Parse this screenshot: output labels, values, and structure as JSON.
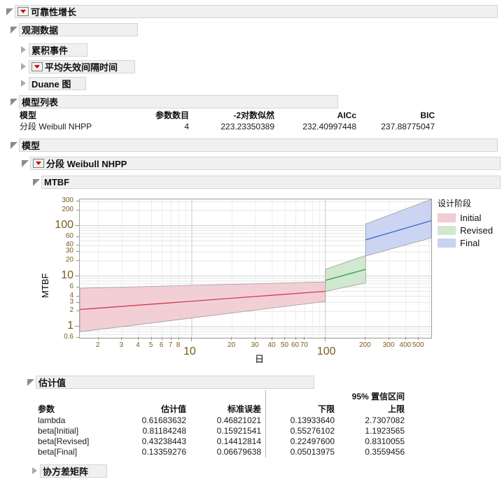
{
  "window": {
    "title": "可靠性增长"
  },
  "outline": {
    "root_label": "可靠性增长",
    "observed_data_label": "观测数据",
    "cumulative_events_label": "累积事件",
    "mtbf_interval_label": "平均失效间隔时间",
    "duane_plot_label": "Duane 图",
    "model_list_label": "模型列表",
    "model_label": "模型",
    "piecewise_weibull_label": "分段 Weibull NHPP",
    "mtbf_label": "MTBF",
    "estimates_label": "估计值",
    "covariance_label": "协方差矩阵"
  },
  "model_list": {
    "headers": [
      "模型",
      "参数数目",
      "-2对数似然",
      "AICc",
      "BIC"
    ],
    "rows": [
      [
        "分段 Weibull NHPP",
        "4",
        "223.23350389",
        "232.40997448",
        "237.88775047"
      ]
    ]
  },
  "estimates": {
    "ci_header": "95% 置信区间",
    "headers": [
      "参数",
      "估计值",
      "标准误差",
      "下限",
      "上限"
    ],
    "rows": [
      [
        "lambda",
        "0.61683632",
        "0.46821021",
        "0.13933640",
        "2.7307082"
      ],
      [
        "beta[Initial]",
        "0.81184248",
        "0.15921541",
        "0.55276102",
        "1.1923565"
      ],
      [
        "beta[Revised]",
        "0.43238443",
        "0.14412814",
        "0.22497600",
        "0.8310055"
      ],
      [
        "beta[Final]",
        "0.13359276",
        "0.06679638",
        "0.05013975",
        "0.3559456"
      ]
    ]
  },
  "chart_data": {
    "type": "line",
    "title": "MTBF",
    "xlabel": "日",
    "ylabel": "MTBF",
    "xscale": "log",
    "yscale": "log",
    "xlim": [
      1.45,
      620
    ],
    "ylim": [
      0.6,
      330
    ],
    "grid": true,
    "legend_position": "right",
    "legend_title": "设计阶段",
    "x_ticks": [
      2,
      3,
      4,
      5,
      6,
      7,
      8,
      10,
      20,
      30,
      40,
      50,
      60,
      70,
      100,
      200,
      300,
      400,
      500
    ],
    "x_major_ticks": [
      10,
      100
    ],
    "y_ticks": [
      0.6,
      1,
      2,
      3,
      4,
      6,
      10,
      20,
      30,
      40,
      60,
      100,
      200,
      300
    ],
    "y_major_ticks": [
      1,
      10,
      100
    ],
    "series": [
      {
        "name": "Initial",
        "color": "#cf3b4e",
        "band_color": "#f1ccd3",
        "band_edge": "#9a9a9a",
        "x_start": 1.45,
        "x_end": 100,
        "fit_start": 2.18,
        "fit_end": 5.0,
        "lower_start": 0.79,
        "lower_end": 3.15,
        "upper_start": 5.75,
        "upper_end": 7.65
      },
      {
        "name": "Revised",
        "color": "#2e9b45",
        "band_color": "#cfe8cf",
        "band_edge": "#9a9a9a",
        "x_start": 100,
        "x_end": 200,
        "fit_start": 8.2,
        "fit_end": 13.6,
        "lower_start": 5.0,
        "lower_end": 7.3,
        "upper_start": 13.6,
        "upper_end": 25.5
      },
      {
        "name": "Final",
        "color": "#3b5fcf",
        "band_color": "#c8d3f0",
        "band_edge": "#9a9a9a",
        "x_start": 200,
        "x_end": 620,
        "fit_start": 52,
        "fit_end": 125,
        "lower_start": 25.0,
        "lower_end": 57.0,
        "upper_start": 107,
        "upper_end": 330
      }
    ],
    "legend_entries": [
      {
        "label": "Initial",
        "color": "#f1ccd3"
      },
      {
        "label": "Revised",
        "color": "#cfe8cf"
      },
      {
        "label": "Final",
        "color": "#c8d3f0"
      }
    ]
  }
}
